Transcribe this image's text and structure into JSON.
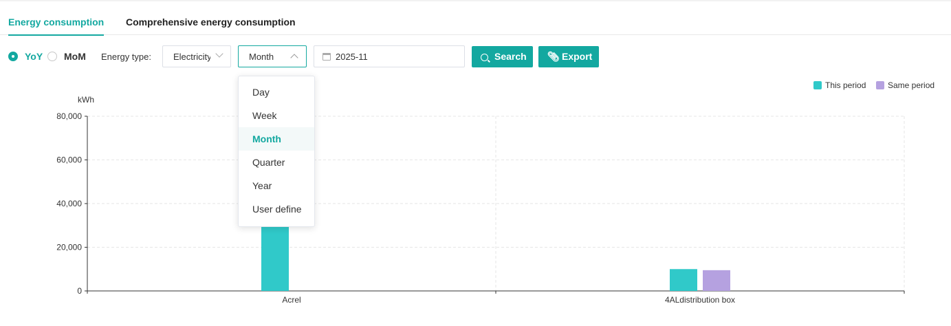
{
  "tabs": [
    {
      "label": "Energy consumption",
      "active": true
    },
    {
      "label": "Comprehensive energy consumption",
      "active": false
    }
  ],
  "compare_mode": {
    "options": [
      {
        "label": "YoY",
        "checked": true
      },
      {
        "label": "MoM",
        "checked": false
      }
    ]
  },
  "filters": {
    "energy_type_label": "Energy type:",
    "energy_type_value": "Electricity",
    "period_value": "Month",
    "date_value": "2025-11"
  },
  "buttons": {
    "search": "Search",
    "export": "Export"
  },
  "period_dropdown": {
    "open": true,
    "options": [
      "Day",
      "Week",
      "Month",
      "Quarter",
      "Year",
      "User define"
    ],
    "selected": "Month"
  },
  "colors": {
    "accent": "#13a8a0",
    "this_period": "#30c9c9",
    "same_period": "#b5a1e0"
  },
  "chart_data": {
    "type": "bar",
    "unit_label": "kWh",
    "categories": [
      "Acrel",
      "4ALdistribution box"
    ],
    "series": [
      {
        "name": "This period",
        "values": [
          30000,
          10000
        ]
      },
      {
        "name": "Same period",
        "values": [
          null,
          9500
        ]
      }
    ],
    "yticks": [
      "0",
      "20,000",
      "40,000",
      "60,000",
      "80,000"
    ],
    "ylim": [
      0,
      80000
    ],
    "grid": true,
    "legend_position": "top-right"
  }
}
